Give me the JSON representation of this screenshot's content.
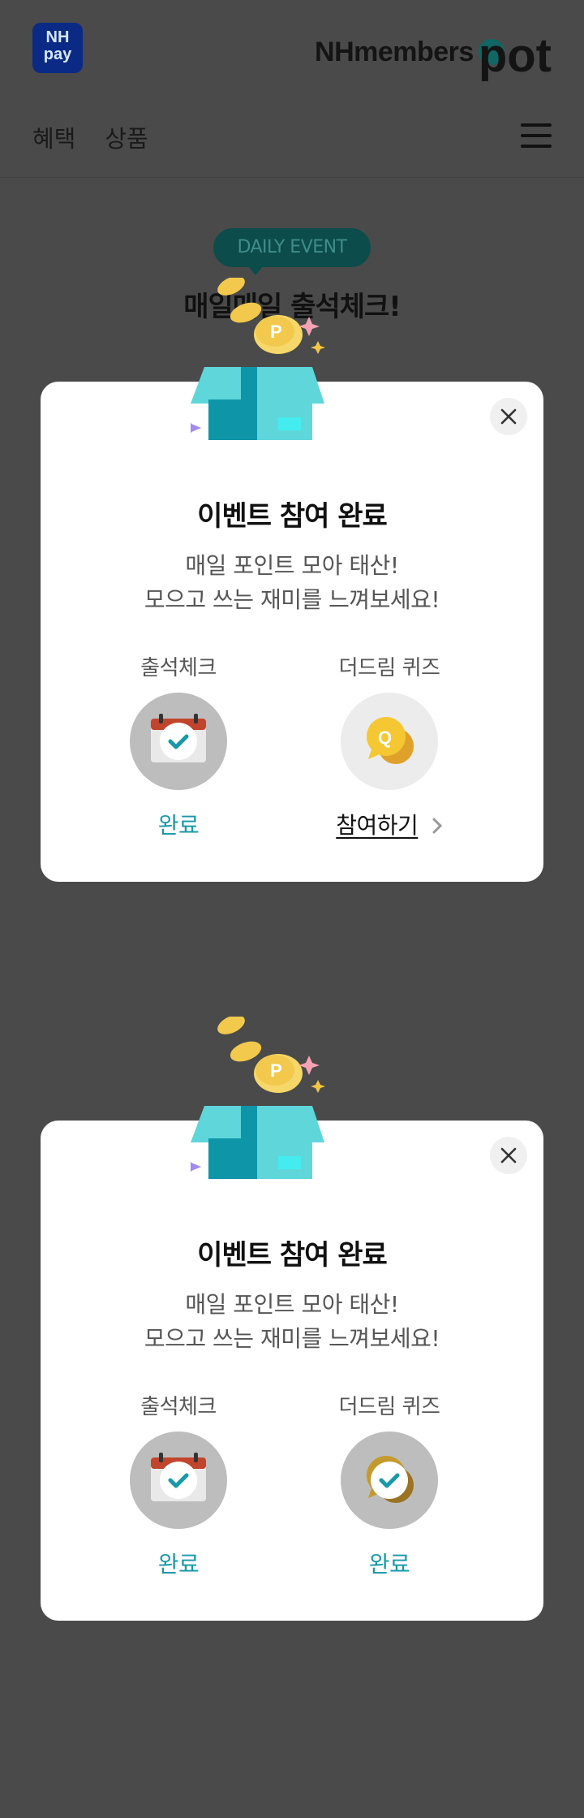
{
  "header": {
    "pay_logo": "NH pay",
    "brand_prefix": "NHmembers",
    "brand_suffix": "pot",
    "nav": [
      "혜택",
      "상품"
    ],
    "menu_icon": "hamburger-menu-icon"
  },
  "event": {
    "badge": "DAILY EVENT",
    "title": "매일매일 출석체크!"
  },
  "modals": [
    {
      "title": "이벤트 참여 완료",
      "subtitle_line1": "매일 포인트 모아 태산!",
      "subtitle_line2": "모으고 쓰는 재미를 느껴보세요!",
      "items": [
        {
          "label": "출석체크",
          "icon": "calendar-check-icon",
          "status": "완료"
        },
        {
          "label": "더드림 퀴즈",
          "icon": "quiz-bubble-icon",
          "action": "참여하기",
          "action_icon": "chevron-right-icon"
        }
      ]
    },
    {
      "title": "이벤트 참여 완료",
      "subtitle_line1": "매일 포인트 모아 태산!",
      "subtitle_line2": "모으고 쓰는 재미를 느껴보세요!",
      "items": [
        {
          "label": "출석체크",
          "icon": "calendar-check-icon",
          "status": "완료"
        },
        {
          "label": "더드림 퀴즈",
          "icon": "quiz-bubble-check-icon",
          "status": "완료"
        }
      ]
    }
  ],
  "colors": {
    "overlay": "#4a4a4a",
    "accent": "#1899a8",
    "badge_bg": "#0c4c4a",
    "modal_bg": "#ffffff"
  }
}
